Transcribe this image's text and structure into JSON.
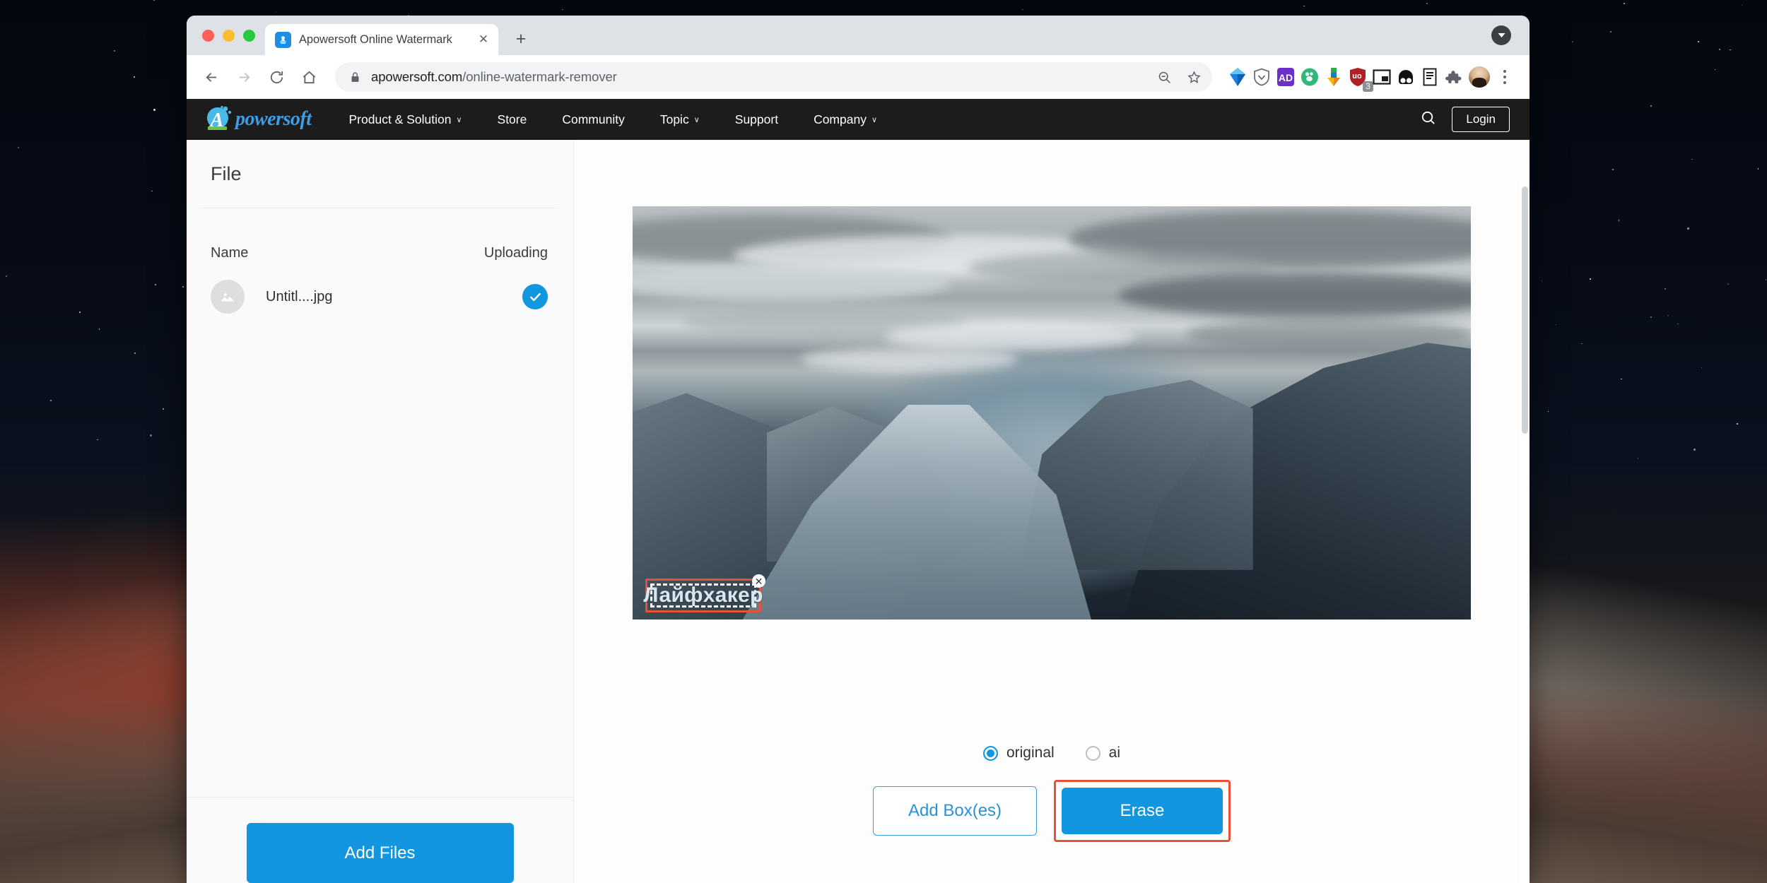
{
  "browser": {
    "window_controls": [
      "close",
      "minimize",
      "maximize"
    ],
    "tab": {
      "title": "Apowersoft Online Watermark ",
      "favicon": "stamp-icon",
      "close_label": "✕"
    },
    "new_tab_label": "+",
    "tab_list_label": "▼",
    "nav": {
      "back": "←",
      "forward": "→",
      "reload": "↻",
      "home": "⌂"
    },
    "omnibox": {
      "lock_icon": "lock-icon",
      "url_domain": "apowersoft.com",
      "url_path": "/online-watermark-remover",
      "zoom_out_icon": "zoom-out-icon",
      "bookmark_icon": "star-icon"
    },
    "extensions": [
      {
        "name": "diamond-extension-icon",
        "badge": ""
      },
      {
        "name": "shield-extension-icon",
        "badge": ""
      },
      {
        "name": "purple-ad-extension-icon",
        "badge": ""
      },
      {
        "name": "green-paw-extension-icon",
        "badge": ""
      },
      {
        "name": "download-extension-icon",
        "badge": ""
      },
      {
        "name": "red-shield-extension-icon",
        "badge": "3"
      },
      {
        "name": "picture-in-picture-icon",
        "badge": ""
      },
      {
        "name": "black-eyes-extension-icon",
        "badge": ""
      },
      {
        "name": "reading-list-icon",
        "badge": ""
      },
      {
        "name": "puzzle-extensions-icon",
        "badge": ""
      }
    ],
    "profile_avatar": "user-avatar",
    "menu_label": "⋮"
  },
  "site_nav": {
    "logo_letter": "A",
    "logo_word": "powersoft",
    "links": [
      {
        "label": "Product & Solution",
        "has_caret": true
      },
      {
        "label": "Store",
        "has_caret": false
      },
      {
        "label": "Community",
        "has_caret": false
      },
      {
        "label": "Topic",
        "has_caret": true
      },
      {
        "label": "Support",
        "has_caret": false
      },
      {
        "label": "Company",
        "has_caret": true
      }
    ],
    "caret": "∨",
    "search_icon": "search-icon",
    "login_label": "Login"
  },
  "sidebar": {
    "title": "File",
    "column_name": "Name",
    "column_status": "Uploading",
    "files": [
      {
        "thumbnail": "image-placeholder-icon",
        "name": "Untitl....jpg",
        "status_icon": "check-circle-icon"
      }
    ],
    "add_files_label": "Add Files"
  },
  "editor": {
    "image_alt": "aerial fjord landscape with cloudy sky",
    "watermark_box": {
      "text": "Лайфхакер",
      "close_label": "✕",
      "highlight_color": "#e8503a"
    },
    "mode_options": [
      {
        "label": "original",
        "selected": true
      },
      {
        "label": "ai",
        "selected": false
      }
    ],
    "add_boxes_label": "Add Box(es)",
    "erase_label": "Erase",
    "erase_highlight_color": "#e8503a"
  },
  "colors": {
    "accent_blue": "#1296e0",
    "outline_blue": "#3c9ddd",
    "nav_dark": "#1c1c1c",
    "highlight_red": "#e8503a"
  }
}
